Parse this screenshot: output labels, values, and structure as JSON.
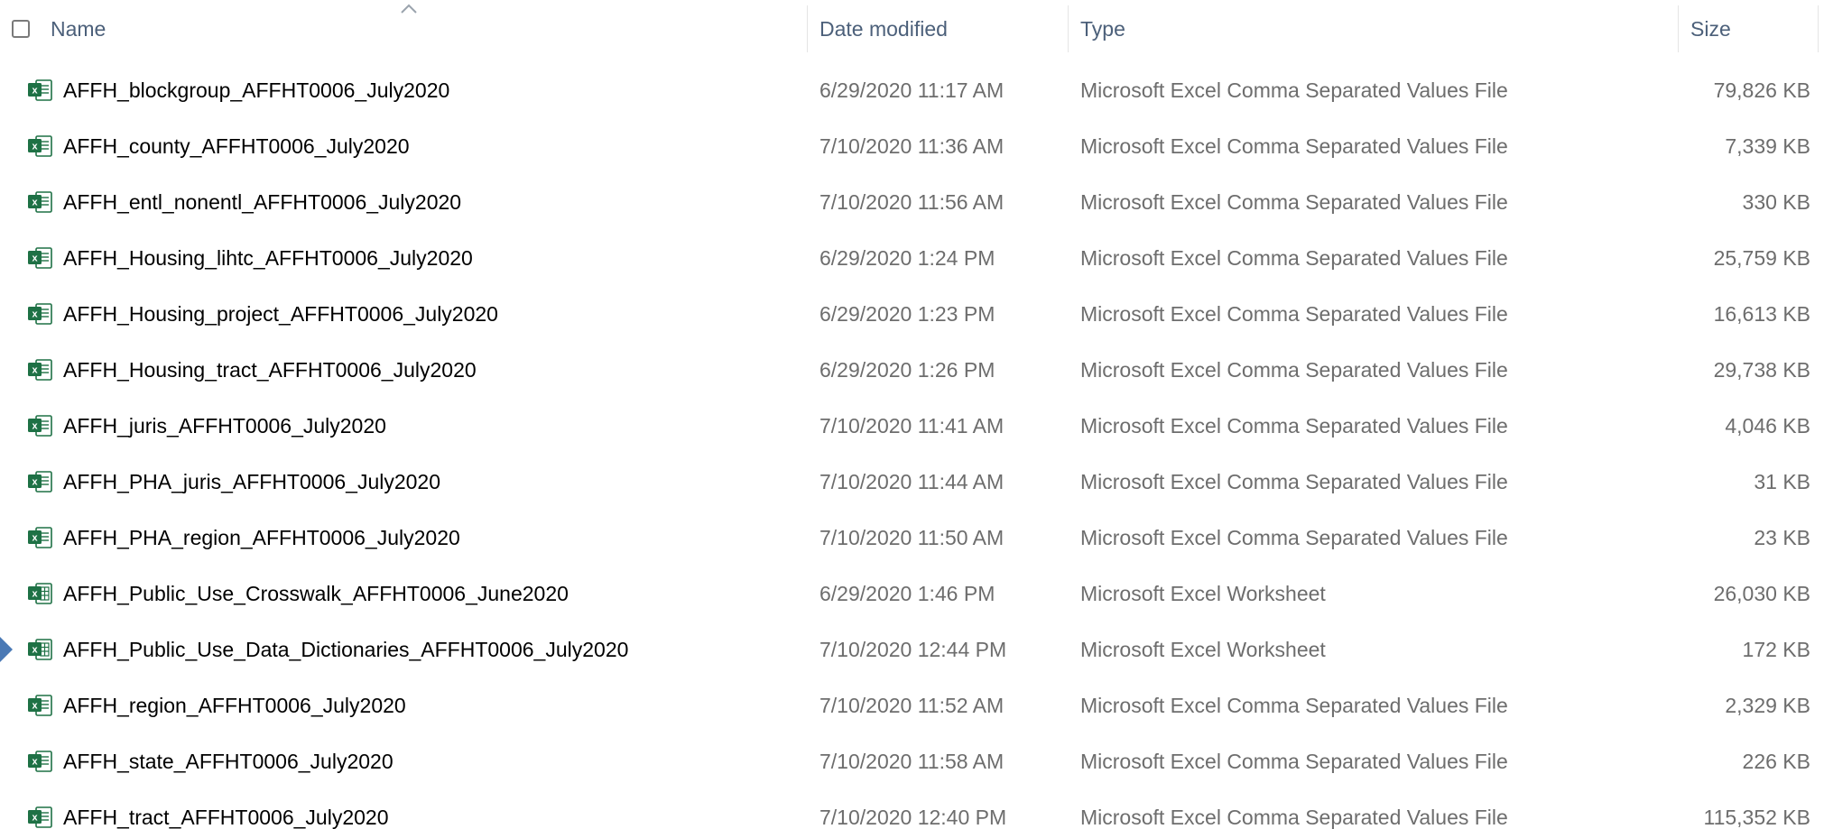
{
  "header": {
    "name_label": "Name",
    "date_label": "Date modified",
    "type_label": "Type",
    "size_label": "Size",
    "sort_icon": "chevron-up-icon"
  },
  "colors": {
    "header_text": "#4c607a",
    "detail_text": "#6d6d6d",
    "excel_green": "#1e7145",
    "pointer_blue": "#4a79b5"
  },
  "files": [
    {
      "name": "AFFH_blockgroup_AFFHT0006_July2020",
      "date": "6/29/2020 11:17 AM",
      "type": "Microsoft Excel Comma Separated Values File",
      "size": "79,826 KB",
      "icon": "csv-file-icon"
    },
    {
      "name": "AFFH_county_AFFHT0006_July2020",
      "date": "7/10/2020 11:36 AM",
      "type": "Microsoft Excel Comma Separated Values File",
      "size": "7,339 KB",
      "icon": "csv-file-icon"
    },
    {
      "name": "AFFH_entl_nonentl_AFFHT0006_July2020",
      "date": "7/10/2020 11:56 AM",
      "type": "Microsoft Excel Comma Separated Values File",
      "size": "330 KB",
      "icon": "csv-file-icon"
    },
    {
      "name": "AFFH_Housing_lihtc_AFFHT0006_July2020",
      "date": "6/29/2020 1:24 PM",
      "type": "Microsoft Excel Comma Separated Values File",
      "size": "25,759 KB",
      "icon": "csv-file-icon"
    },
    {
      "name": "AFFH_Housing_project_AFFHT0006_July2020",
      "date": "6/29/2020 1:23 PM",
      "type": "Microsoft Excel Comma Separated Values File",
      "size": "16,613 KB",
      "icon": "csv-file-icon"
    },
    {
      "name": "AFFH_Housing_tract_AFFHT0006_July2020",
      "date": "6/29/2020 1:26 PM",
      "type": "Microsoft Excel Comma Separated Values File",
      "size": "29,738 KB",
      "icon": "csv-file-icon"
    },
    {
      "name": "AFFH_juris_AFFHT0006_July2020",
      "date": "7/10/2020 11:41 AM",
      "type": "Microsoft Excel Comma Separated Values File",
      "size": "4,046 KB",
      "icon": "csv-file-icon"
    },
    {
      "name": "AFFH_PHA_juris_AFFHT0006_July2020",
      "date": "7/10/2020 11:44 AM",
      "type": "Microsoft Excel Comma Separated Values File",
      "size": "31 KB",
      "icon": "csv-file-icon"
    },
    {
      "name": "AFFH_PHA_region_AFFHT0006_July2020",
      "date": "7/10/2020 11:50 AM",
      "type": "Microsoft Excel Comma Separated Values File",
      "size": "23 KB",
      "icon": "csv-file-icon"
    },
    {
      "name": "AFFH_Public_Use_Crosswalk_AFFHT0006_June2020",
      "date": "6/29/2020 1:46 PM",
      "type": "Microsoft Excel Worksheet",
      "size": "26,030 KB",
      "icon": "xlsx-file-icon"
    },
    {
      "name": "AFFH_Public_Use_Data_Dictionaries_AFFHT0006_July2020",
      "date": "7/10/2020 12:44 PM",
      "type": "Microsoft Excel Worksheet",
      "size": "172 KB",
      "icon": "xlsx-file-icon",
      "pointer": true
    },
    {
      "name": "AFFH_region_AFFHT0006_July2020",
      "date": "7/10/2020 11:52 AM",
      "type": "Microsoft Excel Comma Separated Values File",
      "size": "2,329 KB",
      "icon": "csv-file-icon"
    },
    {
      "name": "AFFH_state_AFFHT0006_July2020",
      "date": "7/10/2020 11:58 AM",
      "type": "Microsoft Excel Comma Separated Values File",
      "size": "226 KB",
      "icon": "csv-file-icon"
    },
    {
      "name": "AFFH_tract_AFFHT0006_July2020",
      "date": "7/10/2020 12:40 PM",
      "type": "Microsoft Excel Comma Separated Values File",
      "size": "115,352 KB",
      "icon": "csv-file-icon"
    }
  ]
}
